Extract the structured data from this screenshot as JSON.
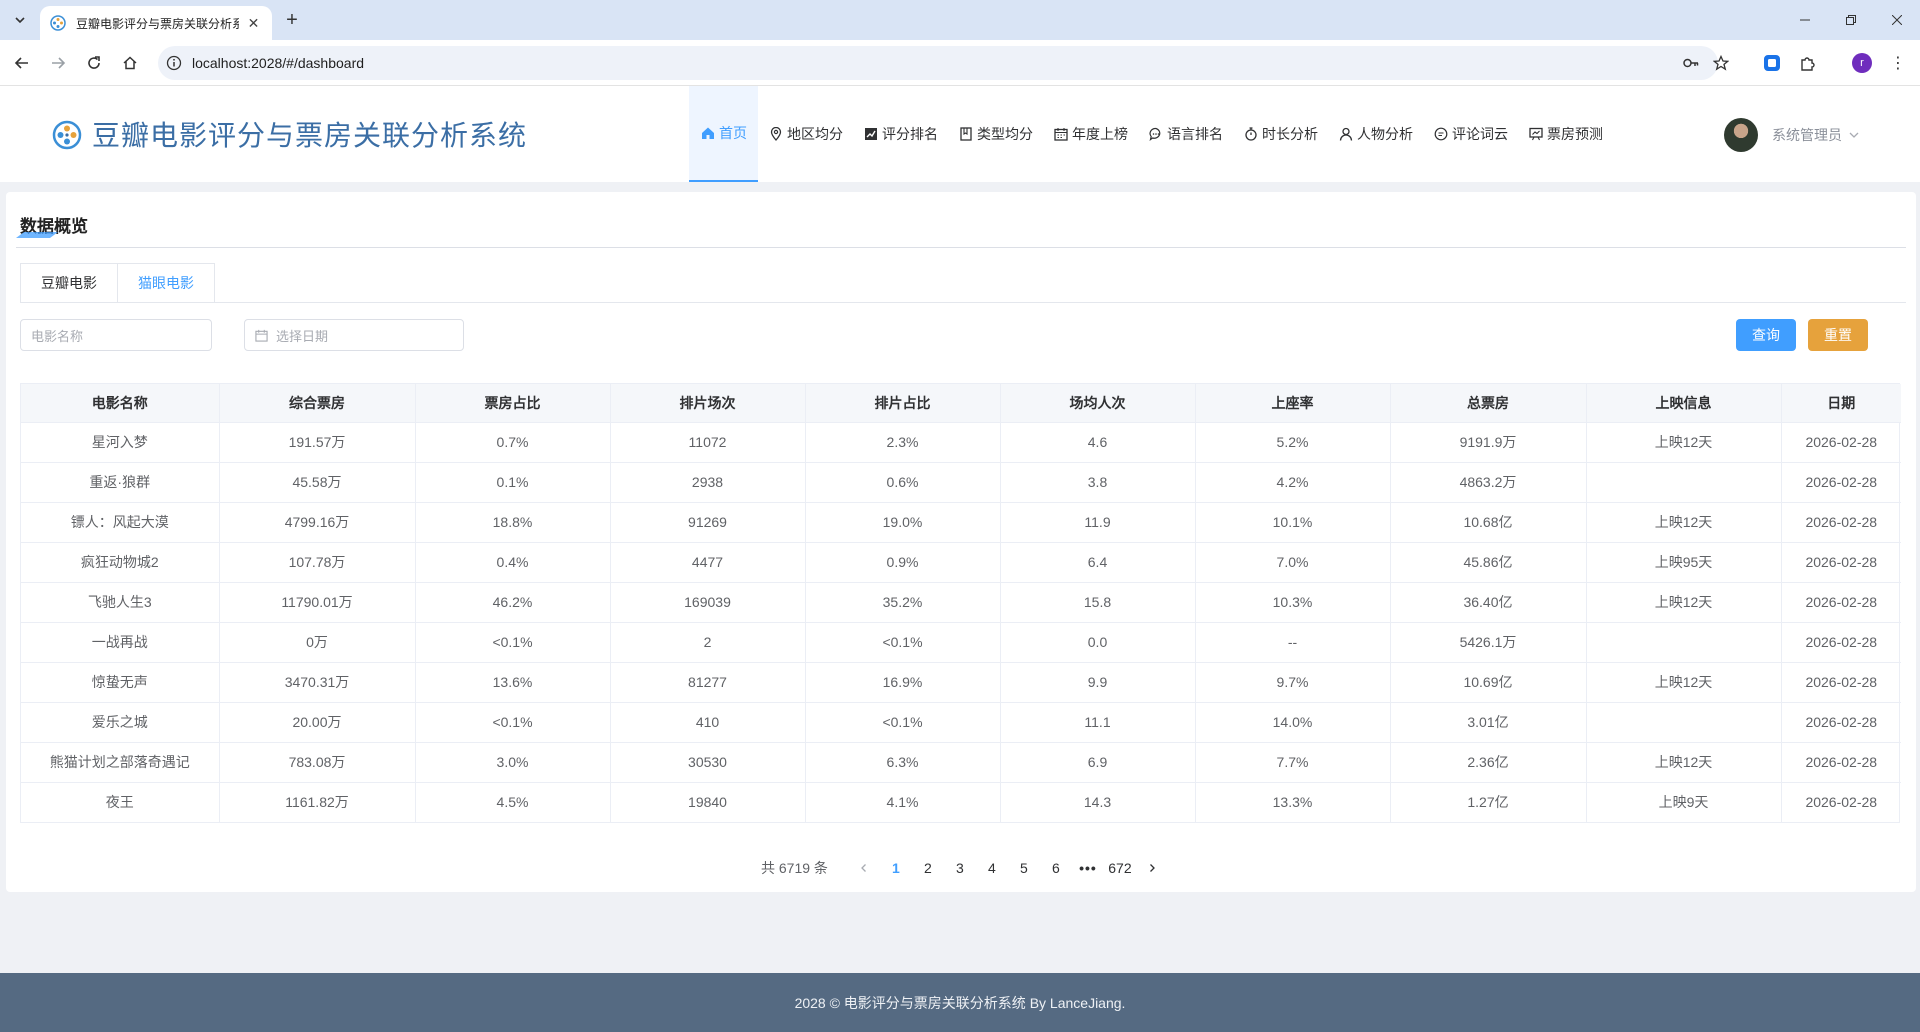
{
  "browser": {
    "tab_title": "豆瓣电影评分与票房关联分析系统",
    "url": "localhost:2028/#/dashboard",
    "profile_initial": "r"
  },
  "header": {
    "title": "豆瓣电影评分与票房关联分析系统",
    "user_name": "系统管理员",
    "menu": [
      {
        "label": "首页",
        "icon": "home-icon",
        "active": true
      },
      {
        "label": "地区均分",
        "icon": "location-icon"
      },
      {
        "label": "评分排名",
        "icon": "trend-chart-icon"
      },
      {
        "label": "类型均分",
        "icon": "notebook-icon"
      },
      {
        "label": "年度上榜",
        "icon": "calendar-icon"
      },
      {
        "label": "语言排名",
        "icon": "chat-icon"
      },
      {
        "label": "时长分析",
        "icon": "stopwatch-icon"
      },
      {
        "label": "人物分析",
        "icon": "user-icon"
      },
      {
        "label": "评论词云",
        "icon": "comment-icon"
      },
      {
        "label": "票房预测",
        "icon": "data-board-icon"
      }
    ]
  },
  "card": {
    "title": "数据概览",
    "tabs": [
      "豆瓣电影",
      "猫眼电影"
    ],
    "filters": {
      "movie_name_placeholder": "电影名称",
      "date_placeholder": "选择日期",
      "query_label": "查询",
      "reset_label": "重置"
    },
    "columns": [
      "电影名称",
      "综合票房",
      "票房占比",
      "排片场次",
      "排片占比",
      "场均人次",
      "上座率",
      "总票房",
      "上映信息",
      "日期"
    ],
    "rows": [
      [
        "星河入梦",
        "191.57万",
        "0.7%",
        "11072",
        "2.3%",
        "4.6",
        "5.2%",
        "9191.9万",
        "上映12天",
        "2026-02-28"
      ],
      [
        "重返·狼群",
        "45.58万",
        "0.1%",
        "2938",
        "0.6%",
        "3.8",
        "4.2%",
        "4863.2万",
        "",
        "2026-02-28"
      ],
      [
        "镖人：风起大漠",
        "4799.16万",
        "18.8%",
        "91269",
        "19.0%",
        "11.9",
        "10.1%",
        "10.68亿",
        "上映12天",
        "2026-02-28"
      ],
      [
        "疯狂动物城2",
        "107.78万",
        "0.4%",
        "4477",
        "0.9%",
        "6.4",
        "7.0%",
        "45.86亿",
        "上映95天",
        "2026-02-28"
      ],
      [
        "飞驰人生3",
        "11790.01万",
        "46.2%",
        "169039",
        "35.2%",
        "15.8",
        "10.3%",
        "36.40亿",
        "上映12天",
        "2026-02-28"
      ],
      [
        "一战再战",
        "0万",
        "<0.1%",
        "2",
        "<0.1%",
        "0.0",
        "--",
        "5426.1万",
        "",
        "2026-02-28"
      ],
      [
        "惊蛰无声",
        "3470.31万",
        "13.6%",
        "81277",
        "16.9%",
        "9.9",
        "9.7%",
        "10.69亿",
        "上映12天",
        "2026-02-28"
      ],
      [
        "爱乐之城",
        "20.00万",
        "<0.1%",
        "410",
        "<0.1%",
        "11.1",
        "14.0%",
        "3.01亿",
        "",
        "2026-02-28"
      ],
      [
        "熊猫计划之部落奇遇记",
        "783.08万",
        "3.0%",
        "30530",
        "6.3%",
        "6.9",
        "7.7%",
        "2.36亿",
        "上映12天",
        "2026-02-28"
      ],
      [
        "夜王",
        "1161.82万",
        "4.5%",
        "19840",
        "4.1%",
        "14.3",
        "13.3%",
        "1.27亿",
        "上映9天",
        "2026-02-28"
      ]
    ],
    "pagination": {
      "total_text": "共 6719 条",
      "pages": [
        "1",
        "2",
        "3",
        "4",
        "5",
        "6"
      ],
      "current": "1",
      "ellipsis": "•••",
      "last": "672"
    }
  },
  "footer": {
    "text": "2028 © 电影评分与票房关联分析系统 By LanceJiang."
  }
}
